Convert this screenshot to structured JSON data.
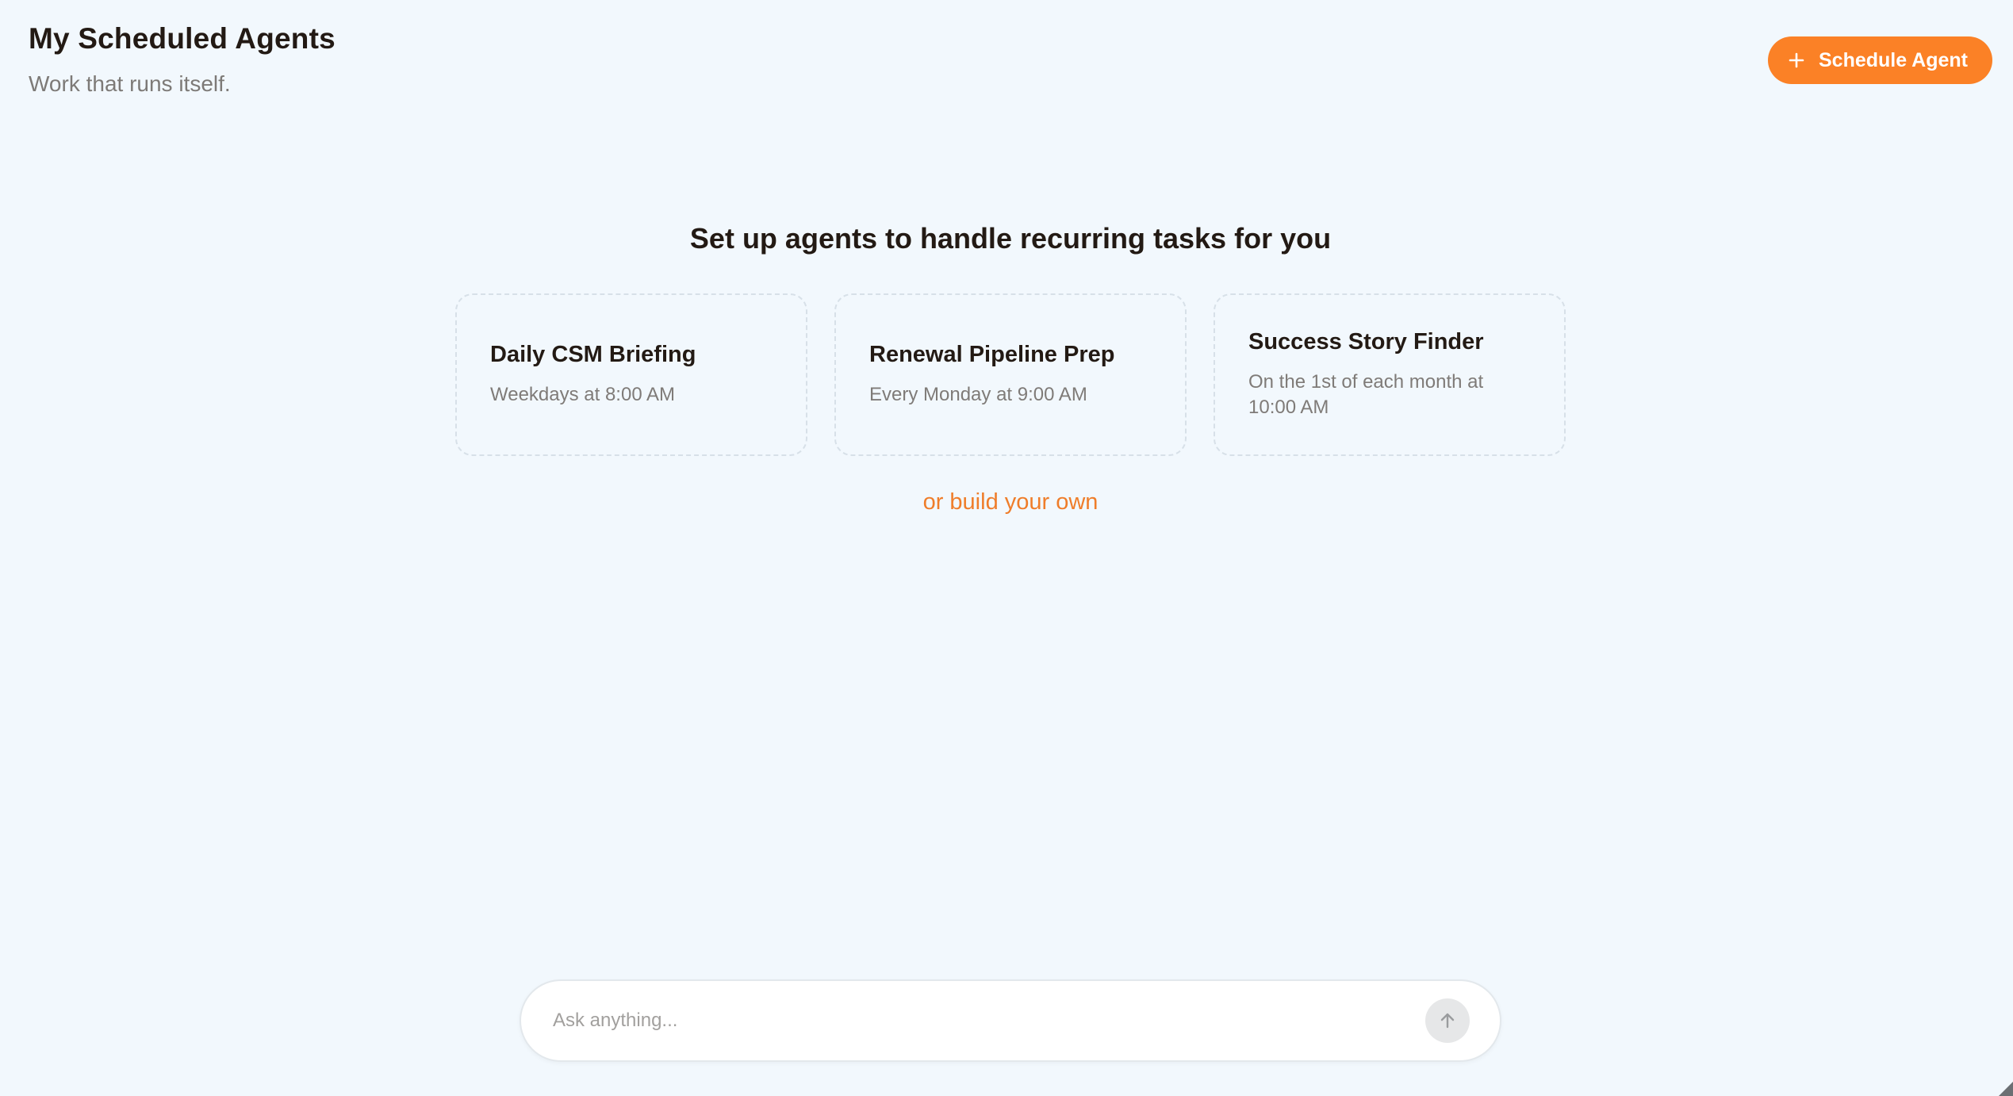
{
  "header": {
    "title": "My Scheduled Agents",
    "subtitle": "Work that runs itself."
  },
  "actions": {
    "schedule_label": "Schedule Agent",
    "schedule_icon": "plus-icon"
  },
  "empty_state": {
    "heading": "Set up agents to handle recurring tasks for you",
    "templates": [
      {
        "title": "Daily CSM Briefing",
        "schedule": "Weekdays at 8:00 AM"
      },
      {
        "title": "Renewal Pipeline Prep",
        "schedule": "Every Monday at 9:00 AM"
      },
      {
        "title": "Success Story Finder",
        "schedule": "On the 1st of each month at 10:00 AM"
      }
    ],
    "build_own_label": "or build your own"
  },
  "chat": {
    "placeholder": "Ask anything...",
    "send_icon": "arrow-up-icon"
  },
  "colors": {
    "background": "#f2f8fd",
    "accent": "#fb8126",
    "link": "#ef7d2a",
    "title_text": "#231a14",
    "muted_text": "#7d7a77"
  }
}
